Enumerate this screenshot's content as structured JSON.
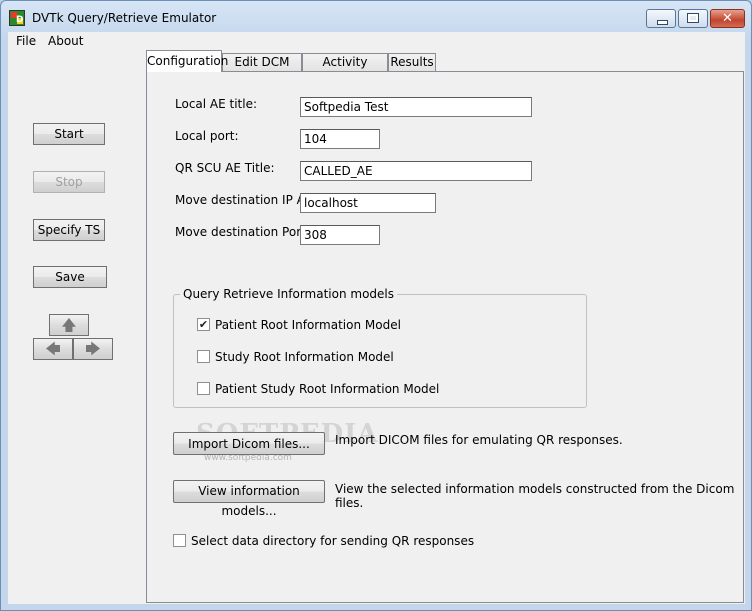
{
  "window": {
    "title": "DVTk Query/Retrieve Emulator"
  },
  "menu": {
    "items": [
      "File",
      "About"
    ]
  },
  "tabs": [
    "Configuration",
    "Edit DCM Files",
    "Activity Logging",
    "Results"
  ],
  "sidebar": {
    "start_label": "Start",
    "stop_label": "Stop",
    "specify_ts_label": "Specify TS",
    "save_label": "Save"
  },
  "config": {
    "local_ae_title": {
      "label": "Local AE title:",
      "value": "Softpedia Test"
    },
    "local_port": {
      "label": "Local port:",
      "value": "104"
    },
    "qr_scu_ae_title": {
      "label": "QR SCU AE Title:",
      "value": "CALLED_AE"
    },
    "move_dest_ip": {
      "label": "Move destination IP Addr:",
      "value": "localhost"
    },
    "move_dest_port": {
      "label": "Move destination Port:",
      "value": "308"
    }
  },
  "models_group": {
    "title": "Query Retrieve Information models",
    "options": [
      {
        "label": "Patient Root Information Model",
        "checked": true
      },
      {
        "label": "Study Root Information Model",
        "checked": false
      },
      {
        "label": "Patient Study Root Information Model",
        "checked": false
      }
    ]
  },
  "actions": {
    "import_label": "Import Dicom files...",
    "import_desc": "Import DICOM files for emulating QR responses.",
    "view_label": "View information models...",
    "view_desc": "View the selected information models constructed from the Dicom files."
  },
  "data_dir": {
    "label": "Select data directory for sending QR responses",
    "checked": false
  },
  "watermark": {
    "text": "SOFTPEDIA",
    "sub": "www.softpedia.com"
  }
}
